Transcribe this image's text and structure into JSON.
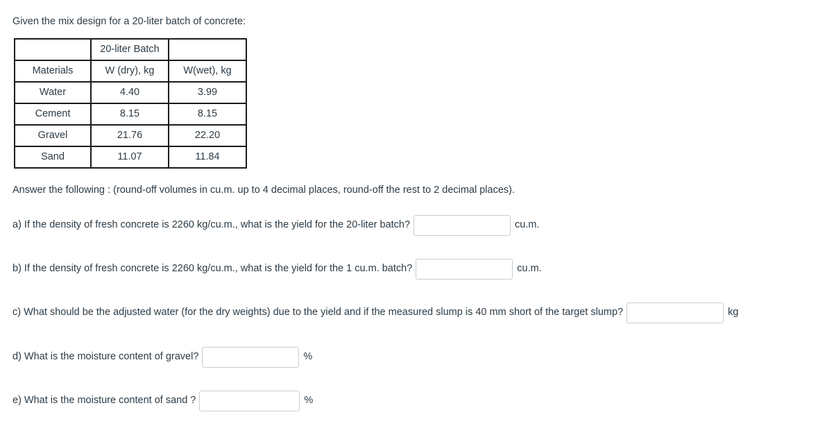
{
  "intro": "Given the mix design for a 20-liter batch of concrete:",
  "table": {
    "header_top": [
      "",
      "20-liter Batch",
      ""
    ],
    "header_cols": [
      "Materials",
      "W (dry), kg",
      "W(wet), kg"
    ],
    "rows": [
      {
        "material": "Water",
        "dry": "4.40",
        "wet": "3.99"
      },
      {
        "material": "Cement",
        "dry": "8.15",
        "wet": "8.15"
      },
      {
        "material": "Gravel",
        "dry": "21.76",
        "wet": "22.20"
      },
      {
        "material": "Sand",
        "dry": "11.07",
        "wet": "11.84"
      }
    ]
  },
  "instructions": "Answer the following :  (round-off volumes in cu.m. up to 4 decimal places, round-off the rest to 2 decimal places).",
  "questions": [
    {
      "id": "a",
      "text": "a) If the density of fresh concrete is 2260 kg/cu.m., what is the yield for the 20-liter batch?",
      "value": "",
      "placeholder": "",
      "unit": "cu.m."
    },
    {
      "id": "b",
      "text": "b) If the density of fresh concrete is 2260 kg/cu.m., what is the yield for the 1 cu.m. batch?",
      "value": "",
      "placeholder": "",
      "unit": "cu.m."
    },
    {
      "id": "c",
      "text": "c) What should be the adjusted water (for the dry weights)  due to the yield and if the measured slump is 40 mm short of the target slump?",
      "value": "",
      "placeholder": "",
      "unit": "kg"
    },
    {
      "id": "d",
      "text": "d) What is the moisture content of gravel?",
      "value": "",
      "placeholder": "",
      "unit": "%"
    },
    {
      "id": "e",
      "text": "e) What is the moisture content of sand ?",
      "value": "",
      "placeholder": "",
      "unit": "%"
    }
  ],
  "colors": {
    "text": "#2d3b45",
    "table_border": "#1b1b1b",
    "input_border": "#c7cdd1",
    "background": "#ffffff"
  }
}
